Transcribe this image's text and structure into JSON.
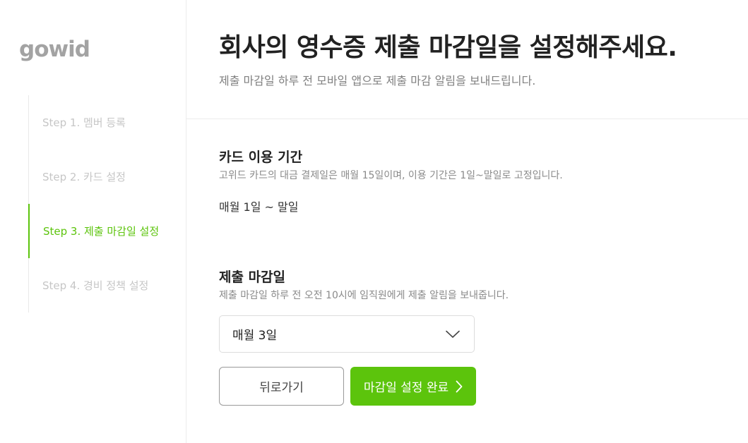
{
  "brand": {
    "logo_text": "gowid",
    "accent_color": "#5cc40c"
  },
  "sidebar": {
    "steps": [
      {
        "label": "Step 1. 멤버 등록",
        "state": "inactive"
      },
      {
        "label": "Step 2. 카드 설정",
        "state": "inactive"
      },
      {
        "label": "Step 3. 제출 마감일 설정",
        "state": "active"
      },
      {
        "label": "Step 4. 경비 정책 설정",
        "state": "inactive"
      }
    ]
  },
  "header": {
    "title": "회사의 영수증 제출 마감일을 설정해주세요.",
    "subtitle": "제출 마감일 하루 전 모바일 앱으로 제출 마감 알림을 보내드립니다."
  },
  "card_period": {
    "title": "카드 이용 기간",
    "description": "고위드 카드의 대금 결제일은 매월 15일이며, 이용 기간은 1일~말일로 고정입니다.",
    "value": "매월 1일 ~ 말일"
  },
  "deadline": {
    "title": "제출 마감일",
    "description": "제출 마감일 하루 전 오전 10시에 임직원에게 제출 알림을 보내줍니다.",
    "select_value": "매월 3일",
    "select_icon": "chevron-down-icon"
  },
  "actions": {
    "back_label": "뒤로가기",
    "done_label": "마감일 설정 완료",
    "done_icon": "chevron-right-icon"
  }
}
